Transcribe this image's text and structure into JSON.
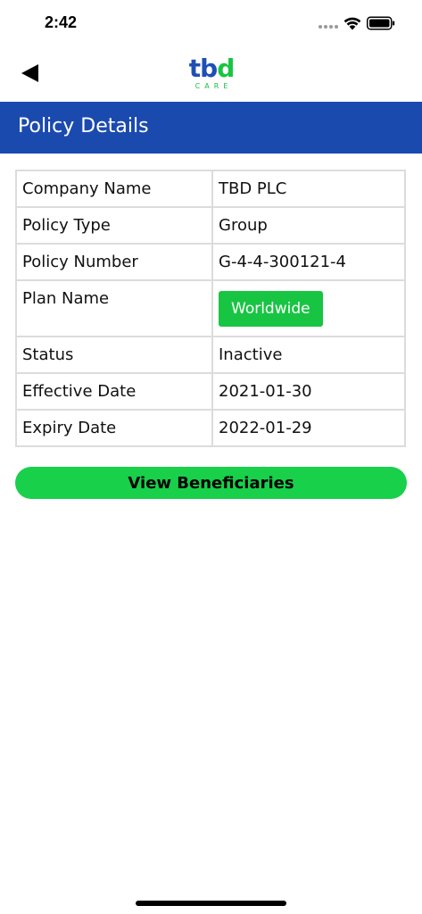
{
  "status_bar": {
    "time": "2:42"
  },
  "header": {
    "logo": {
      "mark_left": "tb",
      "mark_right": "d",
      "subtext": "CARE"
    }
  },
  "page": {
    "title": "Policy Details"
  },
  "details": {
    "rows": [
      {
        "label": "Company Name",
        "value": "TBD PLC"
      },
      {
        "label": "Policy Type",
        "value": "Group"
      },
      {
        "label": "Policy Number",
        "value": "G-4-4-300121-4"
      },
      {
        "label": "Plan Name",
        "value": "Worldwide"
      },
      {
        "label": "Status",
        "value": "Inactive"
      },
      {
        "label": "Effective Date",
        "value": "2021-01-30"
      },
      {
        "label": "Expiry Date",
        "value": "2022-01-29"
      }
    ]
  },
  "actions": {
    "view_beneficiaries_label": "View Beneficiaries"
  },
  "colors": {
    "brand_blue": "#1b4aaf",
    "brand_green": "#18c542",
    "button_green": "#18d04a"
  },
  "icons": {
    "back": "back-icon",
    "wifi": "wifi-icon",
    "battery": "battery-icon"
  }
}
